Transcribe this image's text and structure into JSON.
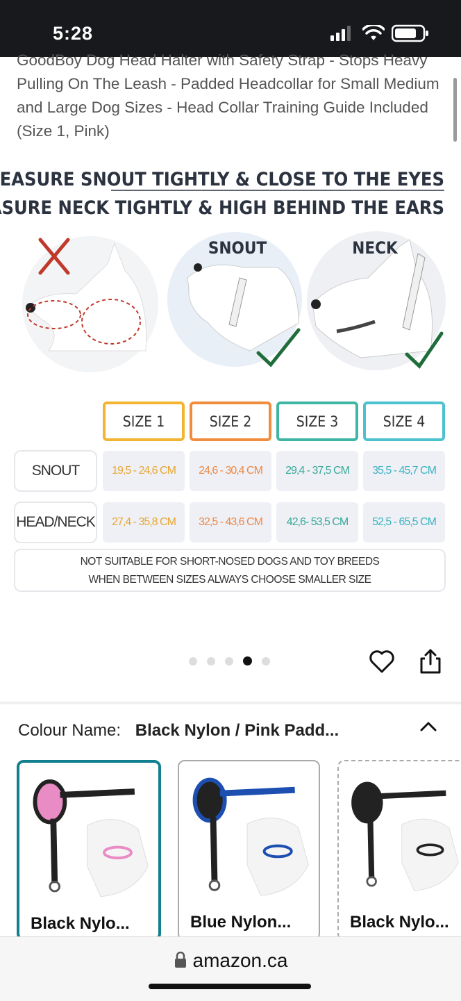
{
  "status_bar": {
    "time": "5:28"
  },
  "product": {
    "title": "GoodBoy Dog Head Halter with Safety Strap - Stops Heavy Pulling On The Leash - Padded Headcollar for Small Medium and Large Dog Sizes - Head Collar Training Guide Included (Size 1, Pink)"
  },
  "image": {
    "headline1": "MEASURE SNOUT TIGHTLY & CLOSE TO THE EYES",
    "headline2": "MEASURE NECK TIGHTLY & HIGH BEHIND THE EARS",
    "circle_snout_label": "SNOUT",
    "circle_neck_label": "NECK",
    "sizes": [
      "SIZE 1",
      "SIZE 2",
      "SIZE 3",
      "SIZE 4"
    ],
    "size_colors": [
      "#f3b431",
      "#f08c3c",
      "#3fb5a4",
      "#4cc2cf"
    ],
    "rows": [
      {
        "label": "SNOUT",
        "values": [
          "19,5 - 24,6 CM",
          "24,6 - 30,4 CM",
          "29,4 - 37,5 CM",
          "35,5 - 45,7 CM"
        ]
      },
      {
        "label": "HEAD/NECK",
        "values": [
          "27,4 - 35,8 CM",
          "32,5 - 43,6 CM",
          "42,6- 53,5 CM",
          "52,5 - 65,5 CM"
        ]
      }
    ],
    "note_line1": "NOT SUITABLE FOR SHORT-NOSED DOGS AND TOY BREEDS",
    "note_line2": "WHEN BETWEEN SIZES ALWAYS CHOOSE SMALLER SIZE"
  },
  "carousel": {
    "count": 5,
    "active_index": 3
  },
  "colour": {
    "label": "Colour Name:",
    "selected": "Black Nylon / Pink Padd..."
  },
  "variants": [
    {
      "label": "Black Nylo...",
      "padding_color": "#e98bc4",
      "strap_color": "#222"
    },
    {
      "label": "Blue Nylon...",
      "padding_color": "#1d4fb0",
      "strap_color": "#1d4fb0"
    },
    {
      "label": "Black Nylo...",
      "padding_color": "#222",
      "strap_color": "#222"
    }
  ],
  "browser": {
    "url": "amazon.ca"
  }
}
